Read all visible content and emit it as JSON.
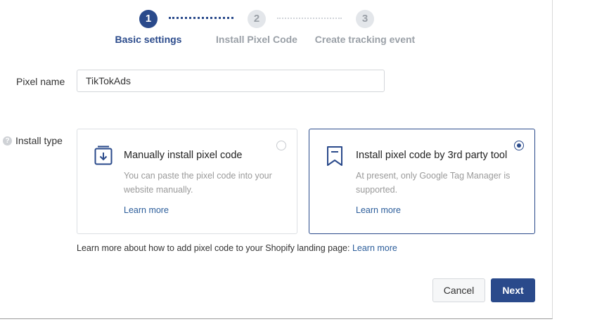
{
  "stepper": {
    "steps": [
      {
        "number": "1",
        "label": "Basic settings",
        "state": "active"
      },
      {
        "number": "2",
        "label": "Install Pixel Code",
        "state": "inactive"
      },
      {
        "number": "3",
        "label": "Create tracking event",
        "state": "inactive"
      }
    ]
  },
  "pixel_name": {
    "label": "Pixel name",
    "value": "TikTokAds"
  },
  "install_type": {
    "label": "Install type",
    "help_icon": "question-icon",
    "options": [
      {
        "icon": "download-box-icon",
        "title": "Manually install pixel code",
        "description": "You can paste the pixel code into your website manually.",
        "link": "Learn more",
        "selected": false
      },
      {
        "icon": "bookmark-icon",
        "title": "Install pixel code by 3rd party tool",
        "description": "At present, only Google Tag Manager is supported.",
        "link": "Learn more",
        "selected": true
      }
    ]
  },
  "footnote": {
    "text": "Learn more about how to add pixel code to your Shopify landing page: ",
    "link": "Learn more"
  },
  "actions": {
    "cancel": "Cancel",
    "next": "Next"
  },
  "colors": {
    "primary": "#2a4a8b",
    "inactive": "#9aa0a7",
    "link": "#2a5c9a"
  }
}
